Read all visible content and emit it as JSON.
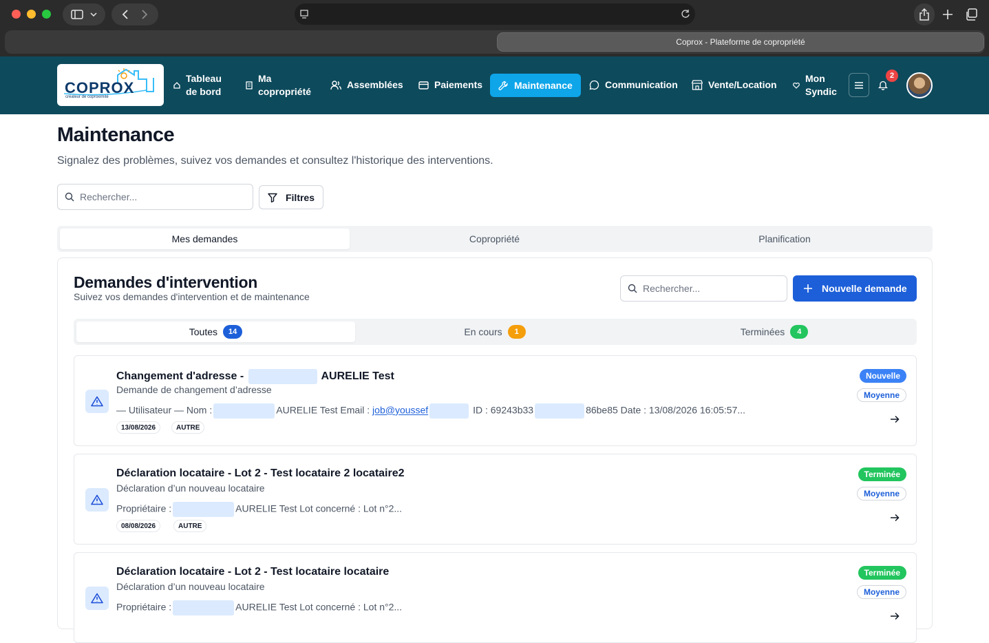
{
  "browser": {
    "tab_title": "Coprox - Plateforme de copropriété"
  },
  "logo": {
    "brand": "COPROX",
    "tagline": "créateur de coproximité"
  },
  "nav": {
    "items": [
      {
        "label_line1": "Tableau",
        "label_line2": "de bord",
        "icon": "home-icon"
      },
      {
        "label_line1": "Ma",
        "label_line2": "copropriété",
        "icon": "building-icon"
      },
      {
        "label": "Assemblées",
        "icon": "users-icon"
      },
      {
        "label": "Paiements",
        "icon": "credit-card-icon"
      },
      {
        "label": "Maintenance",
        "icon": "wrench-icon",
        "active": true
      },
      {
        "label": "Communication",
        "icon": "chat-icon"
      },
      {
        "label": "Vente/Location",
        "icon": "store-icon"
      },
      {
        "label_line1": "Mon",
        "label_line2": "Syndic",
        "icon": "heart-icon"
      }
    ],
    "notifications_count": "2"
  },
  "page": {
    "title": "Maintenance",
    "subtitle": "Signalez des problèmes, suivez vos demandes et consultez l'historique des interventions.",
    "search_placeholder": "Rechercher...",
    "filters_label": "Filtres"
  },
  "main_tabs": [
    {
      "label": "Mes demandes",
      "active": true
    },
    {
      "label": "Copropriété"
    },
    {
      "label": "Planification"
    }
  ],
  "requests_panel": {
    "title": "Demandes d'intervention",
    "subtitle": "Suivez vos demandes d'intervention et de maintenance",
    "search_placeholder": "Rechercher...",
    "new_button": "Nouvelle demande",
    "tabs": [
      {
        "label": "Toutes",
        "count": "14",
        "color": "#1d5fd9",
        "active": true
      },
      {
        "label": "En cours",
        "count": "1",
        "color": "#f59e0b"
      },
      {
        "label": "Terminées",
        "count": "4",
        "color": "#22c55e"
      }
    ]
  },
  "requests": [
    {
      "title_prefix": "Changement d'adresse -",
      "title_suffix": "AURELIE Test",
      "description": "Demande de changement d’adresse",
      "detail_1": "— Utilisateur — Nom :",
      "detail_2": "AURELIE Test Email :",
      "detail_link": "job@youssef",
      "detail_3": "ID : 69243b33",
      "detail_4": "86be85 Date : 13/08/2026 16:05:57...",
      "date": "13/08/2026",
      "category": "AUTRE",
      "status": "Nouvelle",
      "status_color": "#3b82f6",
      "priority": "Moyenne"
    },
    {
      "title": "Déclaration locataire - Lot 2 - Test locataire 2 locataire2",
      "description": "Déclaration d’un nouveau locataire",
      "detail_1": "Propriétaire :",
      "detail_2": "AURELIE Test Lot concerné : Lot n°2...",
      "date": "08/08/2026",
      "category": "AUTRE",
      "status": "Terminée",
      "status_color": "#22c55e",
      "priority": "Moyenne"
    },
    {
      "title": "Déclaration locataire - Lot 2 - Test locataire locataire",
      "description": "Déclaration d’un nouveau locataire",
      "detail_1": "Propriétaire :",
      "detail_2": "AURELIE Test Lot concerné : Lot n°2...",
      "status": "Terminée",
      "status_color": "#22c55e",
      "priority": "Moyenne"
    }
  ]
}
